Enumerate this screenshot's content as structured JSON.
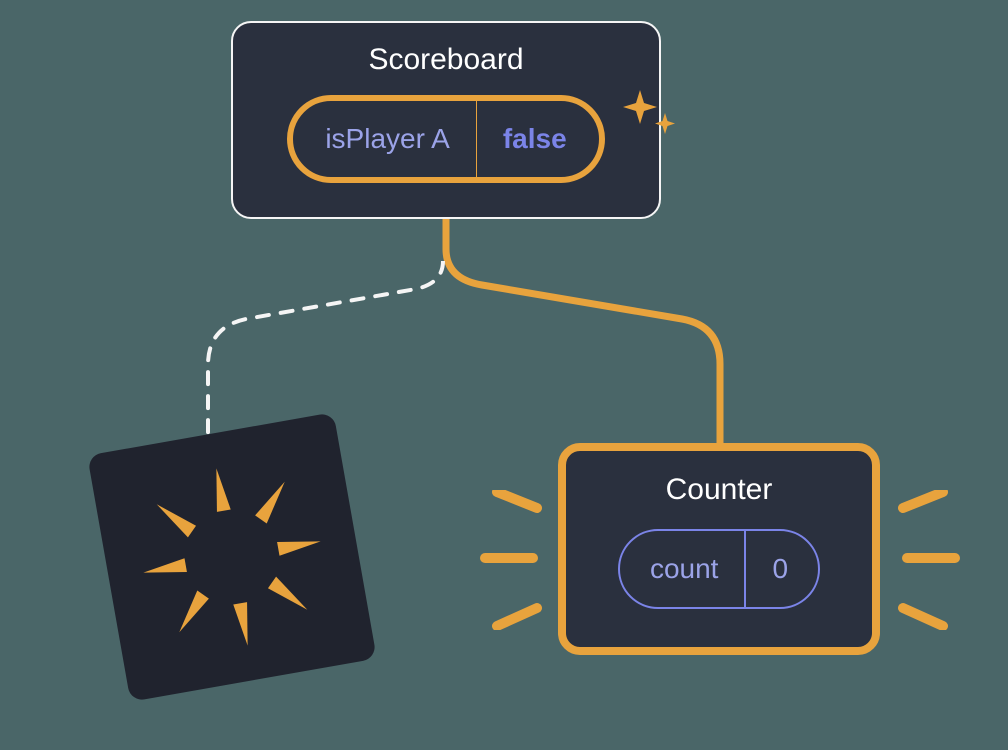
{
  "scoreboard": {
    "title": "Scoreboard",
    "state_key": "isPlayer A",
    "state_value": "false"
  },
  "counter": {
    "title": "Counter",
    "state_key": "count",
    "state_value": "0"
  },
  "colors": {
    "background": "#4a6668",
    "card_bg": "#2a303e",
    "accent_orange": "#e8a33d",
    "accent_purple": "#7b84e8",
    "text_light": "#ffffff"
  },
  "diagram": {
    "edges": [
      {
        "from": "scoreboard",
        "to": "counter",
        "style": "solid",
        "color": "accent_orange"
      },
      {
        "from": "scoreboard",
        "to": "destroyed-node",
        "style": "dashed",
        "color": "white"
      }
    ],
    "destroyed_node": {
      "description": "removed/unmounted component",
      "visual": "burst"
    },
    "highlights": {
      "scoreboard_state_pill": "new",
      "counter_card": "emphasized"
    }
  }
}
